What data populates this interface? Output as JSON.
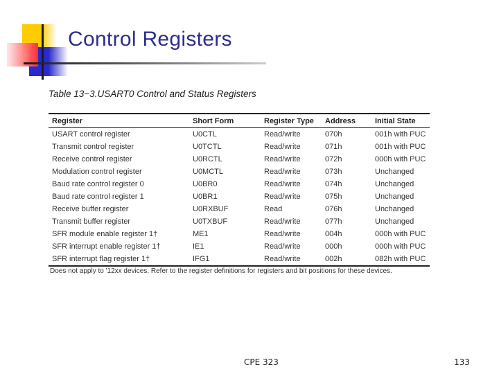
{
  "slide": {
    "title": "Control Registers",
    "footer_center": "CPE 323",
    "page_number": "133"
  },
  "table": {
    "caption": "Table 13−3.USART0 Control and Status Registers",
    "headers": [
      "Register",
      "Short Form",
      "Register Type",
      "Address",
      "Initial State"
    ],
    "rows": [
      [
        "USART control register",
        "U0CTL",
        "Read/write",
        "070h",
        "001h with PUC"
      ],
      [
        "Transmit control register",
        "U0TCTL",
        "Read/write",
        "071h",
        "001h with PUC"
      ],
      [
        "Receive control register",
        "U0RCTL",
        "Read/write",
        "072h",
        "000h with PUC"
      ],
      [
        "Modulation control register",
        "U0MCTL",
        "Read/write",
        "073h",
        "Unchanged"
      ],
      [
        "Baud rate control register 0",
        "U0BR0",
        "Read/write",
        "074h",
        "Unchanged"
      ],
      [
        "Baud rate control register 1",
        "U0BR1",
        "Read/write",
        "075h",
        "Unchanged"
      ],
      [
        "Receive buffer register",
        "U0RXBUF",
        "Read",
        "076h",
        "Unchanged"
      ],
      [
        "Transmit buffer register",
        "U0TXBUF",
        "Read/write",
        "077h",
        "Unchanged"
      ],
      [
        "SFR module enable register 1†",
        "ME1",
        "Read/write",
        "004h",
        "000h with PUC"
      ],
      [
        "SFR interrupt enable register 1†",
        "IE1",
        "Read/write",
        "000h",
        "000h with PUC"
      ],
      [
        "SFR interrupt flag register 1†",
        "IFG1",
        "Read/write",
        "002h",
        "082h with PUC"
      ]
    ],
    "footnote": "Does not apply to '12xx devices. Refer to the register definitions for registers and bit positions for these devices."
  }
}
